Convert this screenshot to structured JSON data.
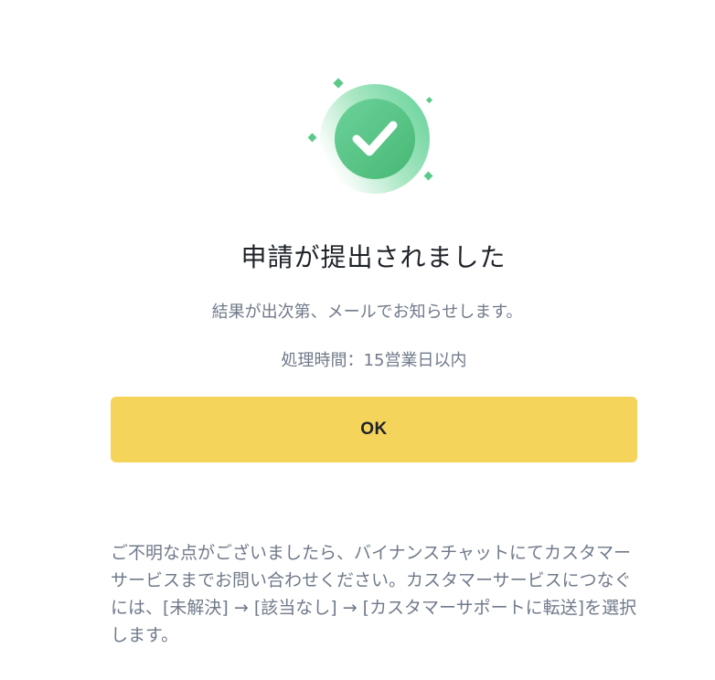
{
  "dialog": {
    "title": "申請が提出されました",
    "subtitle": "結果が出次第、メールでお知らせします。",
    "processing_time": "処理時間：15営業日以内",
    "ok_label": "OK",
    "help_text": "ご不明な点がございましたら、バイナンスチャットにてカスタマーサービスまでお問い合わせください。カスタマーサービスにつなぐには、[未解決] → [該当なし] → [カスタマーサポートに転送]を選択します。"
  },
  "icons": {
    "success": "check-circle-icon",
    "sparkles": "sparkle-icon"
  },
  "colors": {
    "accent_green": "#50bb7d",
    "button_yellow": "#f5d45b",
    "title_text": "#1e2329",
    "secondary_text": "#707a8a"
  }
}
